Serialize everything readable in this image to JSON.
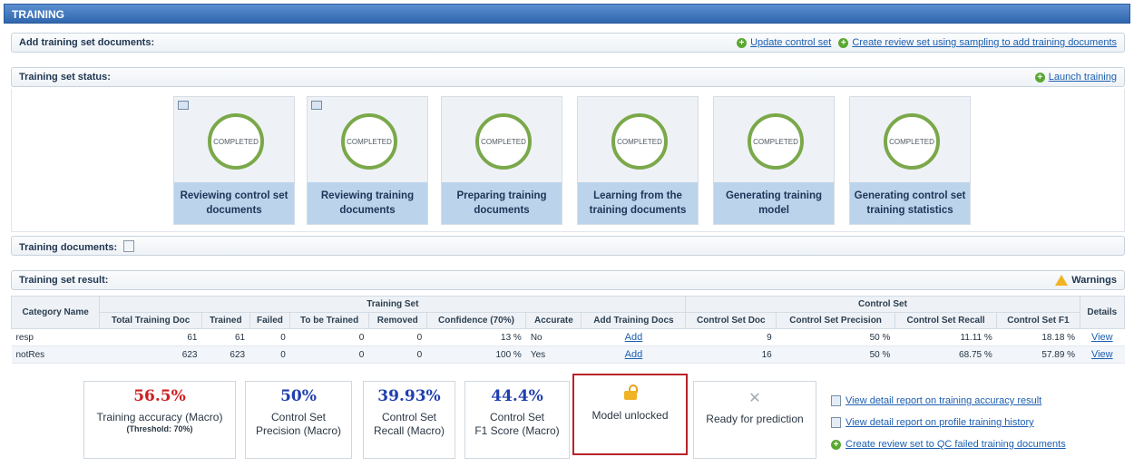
{
  "window_title": "TRAINING",
  "add_docs": {
    "label": "Add training set documents:",
    "link_update": "Update control set",
    "link_create": "Create review set using sampling to add training documents"
  },
  "status": {
    "label": "Training set status:",
    "link_launch": "Launch training",
    "stage_state": "COMPLETED",
    "stages": [
      {
        "caption": "Reviewing control set documents"
      },
      {
        "caption": "Reviewing training documents"
      },
      {
        "caption": "Preparing training documents"
      },
      {
        "caption": "Learning from the training documents"
      },
      {
        "caption": "Generating training model"
      },
      {
        "caption": "Generating control set training statistics"
      }
    ]
  },
  "training_documents": {
    "label": "Training documents:"
  },
  "result": {
    "label": "Training set result:",
    "warnings": "Warnings",
    "group_headers": {
      "category": "Category Name",
      "training_set": "Training Set",
      "control_set": "Control Set",
      "details": "Details"
    },
    "columns": [
      "Total Training Doc",
      "Trained",
      "Failed",
      "To be Trained",
      "Removed",
      "Confidence (70%)",
      "Accurate",
      "Add Training Docs",
      "Control Set Doc",
      "Control Set Precision",
      "Control Set Recall",
      "Control Set F1"
    ],
    "rows": [
      {
        "name": "resp",
        "total": "61",
        "trained": "61",
        "failed": "0",
        "to_be_trained": "0",
        "removed": "0",
        "confidence": "13 %",
        "accurate": "No",
        "add": "Add",
        "cs_doc": "9",
        "precision": "50 %",
        "recall": "11.11 %",
        "f1": "18.18 %",
        "details": "View"
      },
      {
        "name": "notRes",
        "total": "623",
        "trained": "623",
        "failed": "0",
        "to_be_trained": "0",
        "removed": "0",
        "confidence": "100 %",
        "accurate": "Yes",
        "add": "Add",
        "cs_doc": "16",
        "precision": "50 %",
        "recall": "68.75 %",
        "f1": "57.89 %",
        "details": "View"
      }
    ]
  },
  "metrics": {
    "accuracy": {
      "value": "56.5%",
      "label": "Training accuracy (Macro)",
      "threshold": "(Threshold: 70%)",
      "color": "#cc1f1f"
    },
    "precision": {
      "value": "50%",
      "label1": "Control Set",
      "label2": "Precision (Macro)",
      "color": "#1f3fae"
    },
    "recall": {
      "value": "39.93%",
      "label1": "Control Set",
      "label2": "Recall (Macro)",
      "color": "#1f3fae"
    },
    "f1": {
      "value": "44.4%",
      "label1": "Control Set",
      "label2": "F1 Score (Macro)",
      "color": "#1f3fae"
    },
    "model": {
      "label": "Model unlocked",
      "icon": "lock-open-icon"
    },
    "prediction": {
      "label": "Ready for prediction",
      "icon": "x-icon"
    }
  },
  "side_links": {
    "accuracy_report": "View detail report on training accuracy result",
    "history_report": "View detail report on profile training history",
    "qc_review": "Create review set to QC failed training documents"
  },
  "colors": {
    "accent_blue": "#2f66ad",
    "highlight_red": "#b8232b",
    "ring_green": "#7aa84a"
  }
}
